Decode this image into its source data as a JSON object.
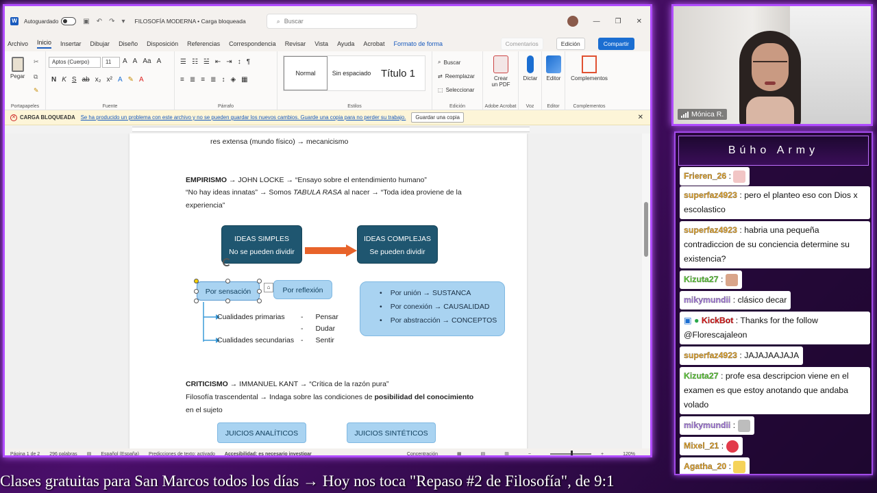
{
  "word": {
    "titlebar": {
      "autosave_label": "Autoguardado",
      "doc_title": "FILOSOFÍA MODERNA • Carga bloqueada",
      "search_placeholder": "Buscar"
    },
    "menu": {
      "tabs": [
        "Archivo",
        "Inicio",
        "Insertar",
        "Dibujar",
        "Diseño",
        "Disposición",
        "Referencias",
        "Correspondencia",
        "Revisar",
        "Vista",
        "Ayuda",
        "Acrobat",
        "Formato de forma"
      ],
      "comments": "Comentarios",
      "edit": "Edición",
      "share": "Compartir"
    },
    "ribbon": {
      "paste": "Pegar",
      "group_clipboard": "Portapapeles",
      "font_name": "Aptos (Cuerpo)",
      "font_size": "11",
      "group_font": "Fuente",
      "group_paragraph": "Párrafo",
      "styles": [
        "Normal",
        "Sin espaciado",
        "Título 1"
      ],
      "group_styles": "Estilos",
      "search": "Buscar",
      "replace": "Reemplazar",
      "select": "Seleccionar",
      "group_editing": "Edición",
      "create_pdf_1": "Crear",
      "create_pdf_2": "un PDF",
      "group_acrobat": "Adobe Acrobat",
      "dictate": "Dictar",
      "group_voice": "Voz",
      "editor": "Editor",
      "group_editor": "Editor",
      "addins": "Complementos",
      "group_addins": "Complementos"
    },
    "warning": {
      "title": "CARGA BLOQUEADA",
      "message": "Se ha producido un problema con este archivo y no se pueden guardar los nuevos cambios. Guarde una copia para no perder su trabajo.",
      "button": "Guardar una copia"
    },
    "document": {
      "top_cut": "res extensa (mundo físico) → mecanicismo",
      "empirismo_label": "EMPIRISMO",
      "empirismo_rest": " → JOHN LOCKE → “Ensayo sobre el entendimiento humano”",
      "empirismo_line2_a": "“No hay ideas innatas” → Somos ",
      "empirismo_line2_b": "TABULA RASA",
      "empirismo_line2_c": " al nacer → “Toda idea proviene de la",
      "empirismo_line3": "experiencia”",
      "ideas_simples_1": "IDEAS SIMPLES",
      "ideas_simples_2": "No se pueden dividir",
      "ideas_complejas_1": "IDEAS COMPLEJAS",
      "ideas_complejas_2": "Se pueden dividir",
      "por_sensacion": "Por sensación",
      "por_reflexion": "Por reflexión",
      "cualidades_primarias": "Cualidades primarias",
      "cualidades_secundarias": "Cualidades secundarias",
      "verbs": [
        "Pensar",
        "Dudar",
        "Sentir"
      ],
      "complejas_items": [
        "Por unión → SUSTANCA",
        "Por conexión → CAUSALIDAD",
        "Por abstracción → CONCEPTOS"
      ],
      "criticismo_label": "CRITICISMO",
      "criticismo_rest": " → IMMANUEL KANT → “Crítica de la razón pura”",
      "criticismo_line2_a": "Filosofía trascendental → Indaga sobre las condiciones de ",
      "criticismo_line2_b": "posibilidad del conocimiento",
      "criticismo_line3": "en el sujeto",
      "juicios_analiticos": "JUICIOS ANALÍTICOS",
      "juicios_sinteticos": "JUICIOS SINTÉTICOS"
    },
    "status": {
      "page": "Página 1 de 2",
      "words": "296 palabras",
      "language": "Español (España)",
      "predictions": "Predicciones de texto: activado",
      "accessibility": "Accesibilidad: es necesario investigar",
      "focus": "Concentración",
      "zoom": "120%"
    }
  },
  "webcam": {
    "name": "Mónica R."
  },
  "chat": {
    "title": "Búho Army",
    "messages": [
      {
        "user": "Frieren_26",
        "text": "",
        "color": "orange"
      },
      {
        "user": "superfaz4923",
        "text": "pero el planteo eso con Dios x escolastico",
        "color": "orange"
      },
      {
        "user": "superfaz4923",
        "text": "habria una pequeña contradiccion de su conciencia determine su existencia?",
        "color": "orange"
      },
      {
        "user": "Kizuta27",
        "text": "",
        "color": "green"
      },
      {
        "user": "mikymundii",
        "text": "clásico decar",
        "color": "purple"
      },
      {
        "user": "KickBot",
        "text": "Thanks for the follow @Florescajaleon",
        "color": "red"
      },
      {
        "user": "superfaz4923",
        "text": "JAJAJAAJAJA",
        "color": "orange"
      },
      {
        "user": "Kizuta27",
        "text": "profe esa descripcion viene en el examen es que estoy anotando que andaba volado",
        "color": "green"
      },
      {
        "user": "mikymundii",
        "text": "",
        "color": "purple"
      },
      {
        "user": "Mixel_21",
        "text": "",
        "color": "orange"
      },
      {
        "user": "Agatha_20",
        "text": "",
        "color": "orange"
      }
    ]
  },
  "ticker": "Clases gratuitas para San Marcos todos los días  →  Hoy nos toca \"Repaso #2 de Filosofía\", de 9:1"
}
